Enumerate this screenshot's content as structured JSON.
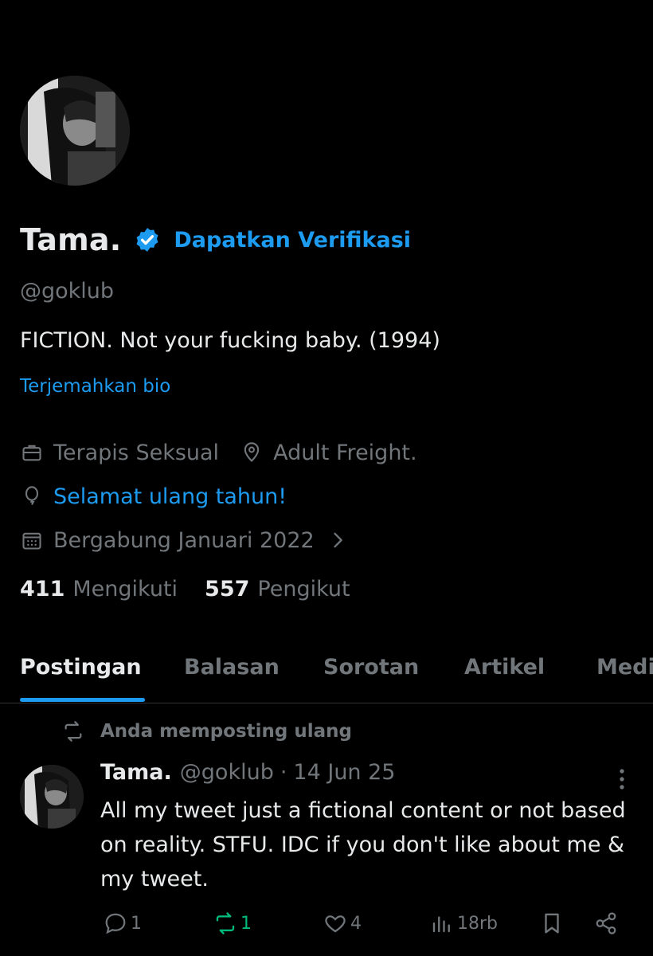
{
  "profile": {
    "display_name": "Tama.",
    "verify_cta": "Dapatkan Verifikasi",
    "handle": "@goklub",
    "bio": "FICTION. Not your fucking baby. (1994)",
    "translate_bio": "Terjemahkan bio",
    "profession": "Terapis Seksual",
    "location": "Adult Freight.",
    "birthday": "Selamat ulang tahun!",
    "joined": "Bergabung Januari 2022",
    "following_count": "411",
    "following_label": "Mengikuti",
    "followers_count": "557",
    "followers_label": "Pengikut"
  },
  "tabs": [
    {
      "label": "Postingan"
    },
    {
      "label": "Balasan"
    },
    {
      "label": "Sorotan"
    },
    {
      "label": "Artikel"
    },
    {
      "label": "Medi"
    }
  ],
  "post": {
    "repost_label": "Anda memposting ulang",
    "author_name": "Tama.",
    "author_handle": "@goklub",
    "separator": "·",
    "date": "14 Jun 25",
    "text": "All my tweet just a fictional content or not based on reality. STFU. IDC if you don't like about me & my tweet.",
    "actions": {
      "replies": "1",
      "reposts": "1",
      "likes": "4",
      "views": "18rb"
    }
  },
  "colors": {
    "background": "#000000",
    "text_primary": "#e7e9ea",
    "text_secondary": "#71767b",
    "accent": "#1d9bf0",
    "repost_green": "#00ba7c"
  }
}
